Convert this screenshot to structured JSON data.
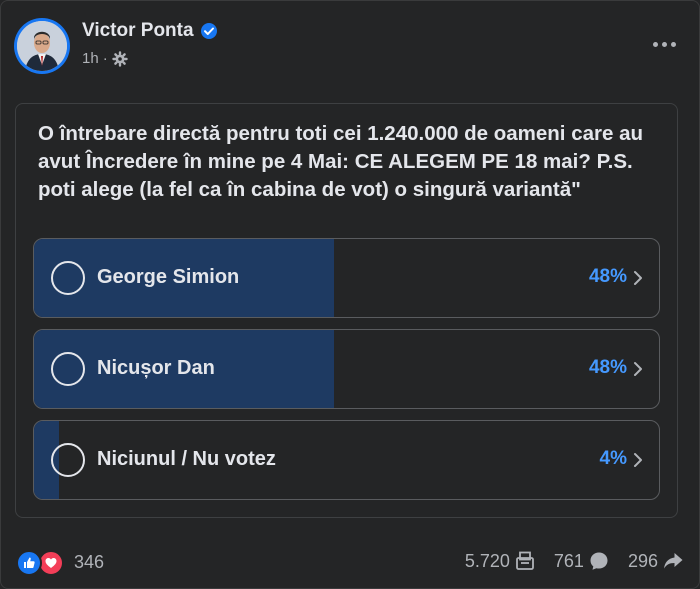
{
  "post": {
    "author": "Victor Ponta",
    "time": "1h",
    "separator": "·"
  },
  "poll": {
    "question": "O întrebare directă pentru toti cei 1.240.000 de oameni care au avut Încredere în mine pe 4 Mai: CE ALEGEM PE 18 mai? P.S. poti alege (la fel ca în cabina de vot) o singură variantă\"",
    "options": [
      {
        "label": "George Simion",
        "percent_text": "48%",
        "share": 0.48
      },
      {
        "label": "Nicușor Dan",
        "percent_text": "48%",
        "share": 0.48
      },
      {
        "label": "Niciunul / Nu votez",
        "percent_text": "4%",
        "share": 0.04
      }
    ],
    "fill_color": "#1e3a62",
    "percent_color": "#4599ff"
  },
  "footer": {
    "reactions_count": "346",
    "votes_count": "5.720",
    "comments_count": "761",
    "shares_count": "296"
  },
  "icons": {
    "verified": "verified-badge-icon",
    "audience": "gear-icon",
    "more": "more-options-icon",
    "votes": "poll-votes-icon",
    "comments": "comment-icon",
    "shares": "share-icon"
  },
  "colors": {
    "background": "#242526",
    "accent": "#1877f2",
    "love": "#f33e58"
  }
}
